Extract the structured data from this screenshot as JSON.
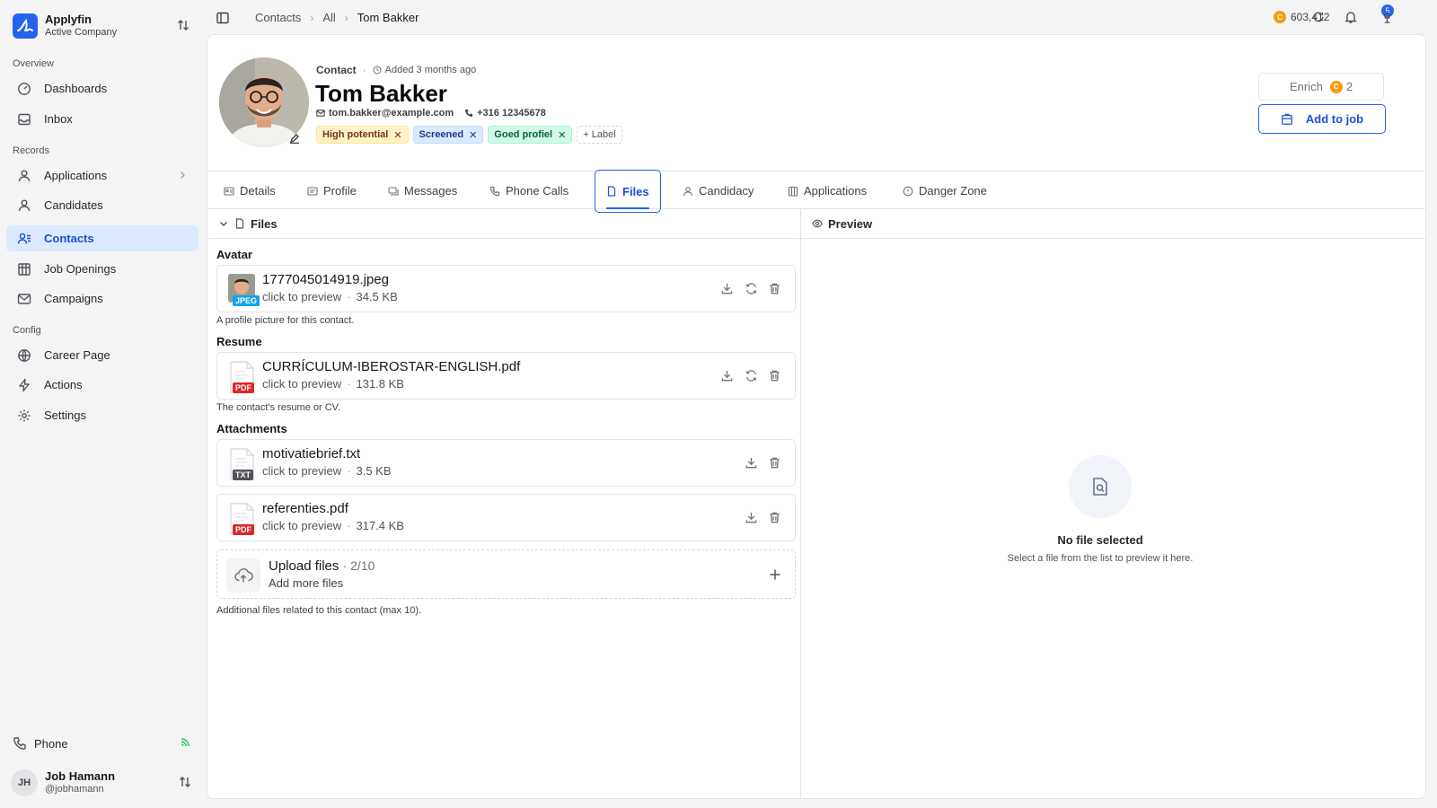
{
  "brand": {
    "name": "Applyfin",
    "company": "Active Company"
  },
  "sidebar": {
    "sections": {
      "overview": "Overview",
      "records": "Records",
      "config": "Config"
    },
    "items": [
      {
        "label": "Dashboards",
        "icon": "dashboard-icon"
      },
      {
        "label": "Inbox",
        "icon": "inbox-icon"
      },
      {
        "label": "Applications",
        "icon": "applications-icon"
      },
      {
        "label": "Candidates",
        "icon": "candidates-icon"
      },
      {
        "label": "Contacts",
        "icon": "contacts-icon",
        "active": true
      },
      {
        "label": "Job Openings",
        "icon": "building-icon"
      },
      {
        "label": "Campaigns",
        "icon": "mail-icon"
      },
      {
        "label": "Career Page",
        "icon": "globe-icon"
      },
      {
        "label": "Actions",
        "icon": "bolt-icon"
      },
      {
        "label": "Settings",
        "icon": "gear-icon"
      }
    ],
    "phone": "Phone",
    "user": {
      "initials": "JH",
      "name": "Job Hamann",
      "handle": "@jobhamann"
    }
  },
  "topbar": {
    "breadcrumb": [
      "Contacts",
      "All",
      "Tom Bakker"
    ],
    "credits": "603,412",
    "coin_symbol": "C",
    "notifications": "5"
  },
  "contact": {
    "kind": "Contact",
    "added": "Added 3 months ago",
    "name": "Tom Bakker",
    "email": "tom.bakker@example.com",
    "phone": "+316 12345678",
    "labels": [
      {
        "text": "High potential",
        "color": "#fef3c7"
      },
      {
        "text": "Screened",
        "color": "#dbeafe"
      },
      {
        "text": "Goed profiel",
        "color": "#d1fae5"
      }
    ],
    "add_label": "+ Label",
    "enrich_label": "Enrich",
    "enrich_cost": "2",
    "add_to_job": "Add to job"
  },
  "tabs": [
    "Details",
    "Profile",
    "Messages",
    "Phone Calls",
    "Files",
    "Candidacy",
    "Applications",
    "Danger Zone"
  ],
  "active_tab": "Files",
  "files": {
    "panel_title": "Files",
    "avatar": {
      "title": "Avatar",
      "file": {
        "name": "1777045014919.jpeg",
        "preview": "click to preview",
        "size": "34.5 KB",
        "type": "JPEG"
      },
      "helper": "A profile picture for this contact."
    },
    "resume": {
      "title": "Resume",
      "file": {
        "name": "CURRÍCULUM-IBEROSTAR-ENGLISH.pdf",
        "preview": "click to preview",
        "size": "131.8 KB",
        "type": "PDF"
      },
      "helper": "The contact's resume or CV."
    },
    "attachments": {
      "title": "Attachments",
      "files": [
        {
          "name": "motivatiebrief.txt",
          "preview": "click to preview",
          "size": "3.5 KB",
          "type": "TXT"
        },
        {
          "name": "referenties.pdf",
          "preview": "click to preview",
          "size": "317.4 KB",
          "type": "PDF"
        }
      ],
      "upload": {
        "title": "Upload files",
        "count": "· 2/10",
        "sub": "Add more files"
      },
      "helper": "Additional files related to this contact (max 10)."
    }
  },
  "preview": {
    "title": "Preview",
    "empty_title": "No file selected",
    "empty_sub": "Select a file from the list to preview it here."
  },
  "colors": {
    "accent": "#2563eb",
    "pdf": "#dc2626",
    "jpeg": "#0ea5e9",
    "txt": "#52525b"
  }
}
